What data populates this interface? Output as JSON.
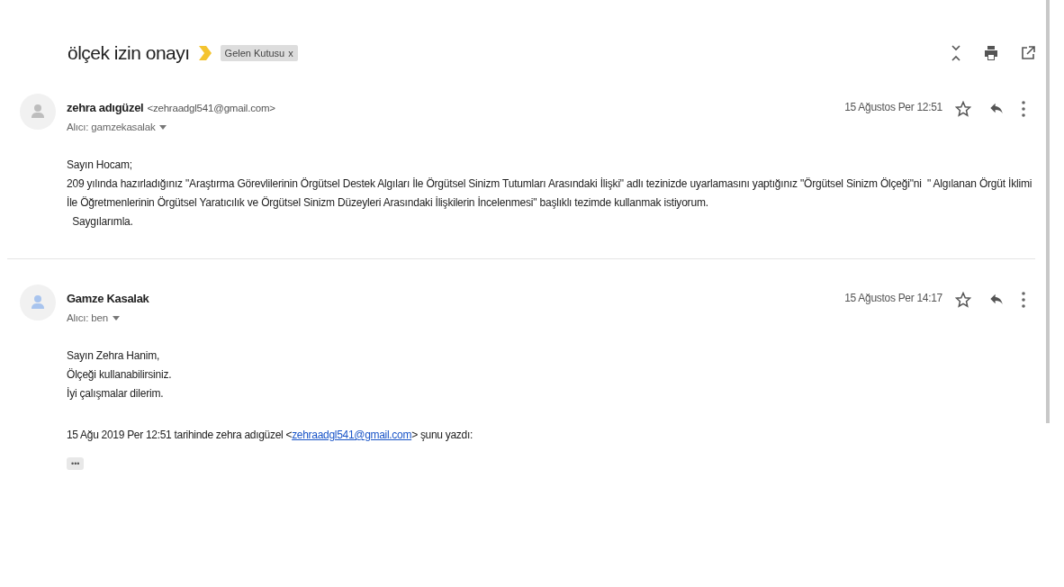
{
  "subject": "ölçek izin onayı",
  "label": {
    "text": "Gelen Kutusu",
    "close": "x"
  },
  "messages": [
    {
      "sender": "zehra adıgüzel",
      "email": "<zehraadgl541@gmail.com>",
      "recipient": "Alıcı: gamzekasalak",
      "date": "15 Ağustos Per 12:51",
      "color": "#bdbdbd",
      "starred": false,
      "body": [
        "Sayın Hocam;",
        "209 yılında hazırladığınız \"Araştırma Görevlilerinin Örgütsel Destek Algıları İle Örgütsel Sinizm Tutumları Arasındaki İlişki\" adlı tezinizde uyarlamasını yaptığınız \"Örgütsel Sinizm Ölçeği\"ni  \" Algılanan Örgüt İklimi İle Öğretmenlerinin Örgütsel Yaratıcılık ve Örgütsel Sinizm Düzeyleri Arasındaki İlişkilerin İncelenmesi\" başlıklı tezimde kullanmak istiyorum.",
        "  Saygılarımla."
      ]
    },
    {
      "sender": "Gamze Kasalak",
      "recipient": "Alıcı: ben",
      "date": "15 Ağustos Per 14:17",
      "color": "#a8c4ee",
      "starred": false,
      "body": [
        "Sayın Zehra Hanim,",
        "Ölçeği kullanabilirsiniz.",
        "İyi çalışmalar dilerim."
      ],
      "quote": {
        "before": "15 Ağu 2019 Per 12:51 tarihinde zehra adıgüzel <",
        "link": "zehraadgl541@gmail.com",
        "after": "> şunu yazdı:"
      },
      "expand": "•••"
    }
  ]
}
